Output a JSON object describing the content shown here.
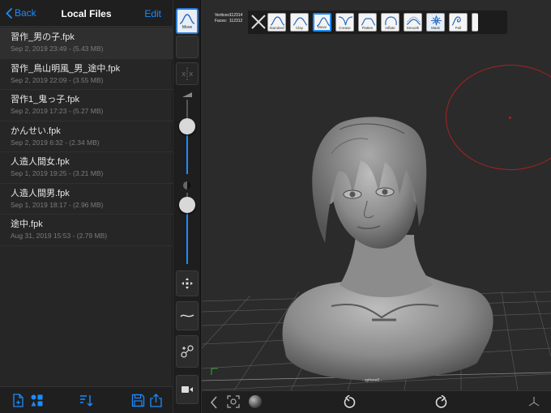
{
  "nav": {
    "back_label": "Back",
    "title": "Local Files",
    "edit_label": "Edit"
  },
  "files": [
    {
      "name": "習作_男の子.fpk",
      "meta": "Sep 2, 2019 23:49 - (5.43 MB)"
    },
    {
      "name": "習作_鳥山明風_男_途中.fpk",
      "meta": "Sep 2, 2019 22:09 - (3.55 MB)"
    },
    {
      "name": "習作1_鬼っ子.fpk",
      "meta": "Sep 2, 2019 17:23 - (5.27 MB)"
    },
    {
      "name": "かんせい.fpk",
      "meta": "Sep 2, 2019 6:32 - (2.34 MB)"
    },
    {
      "name": "人造人間女.fpk",
      "meta": "Sep 1, 2019 19:25 - (3.21 MB)"
    },
    {
      "name": "人造人間男.fpk",
      "meta": "Sep 1, 2019 18:17 - (2.96 MB)"
    },
    {
      "name": "途中.fpk",
      "meta": "Aug 31, 2019 15:53 - (2.79 MB)"
    }
  ],
  "tools": {
    "active_tool_label": "Move",
    "radius_slider_value": 0.36,
    "intensity_slider_value": 0.17
  },
  "stats": {
    "vertices_label": "Vertices:",
    "vertices_value": "112314",
    "faces_label": "Faces:",
    "faces_value": "112312"
  },
  "brushes": [
    {
      "label": "Standard",
      "icon": "standard-brush-icon"
    },
    {
      "label": "Clay",
      "icon": "clay-brush-icon"
    },
    {
      "label": "Move",
      "icon": "move-brush-icon",
      "selected": true
    },
    {
      "label": "Crease",
      "icon": "crease-brush-icon"
    },
    {
      "label": "Flatten",
      "icon": "flatten-brush-icon"
    },
    {
      "label": "Inflate",
      "icon": "inflate-brush-icon"
    },
    {
      "label": "Smooth",
      "icon": "smooth-brush-icon"
    },
    {
      "label": "Mask",
      "icon": "mask-brush-icon"
    },
    {
      "label": "Pull",
      "icon": "pull-brush-icon"
    }
  ],
  "viewport": {
    "object_label": "- sphere0 -"
  },
  "colors": {
    "accent": "#1b8cff",
    "brush_cursor": "#a82222",
    "background": "#2b2b2b"
  }
}
